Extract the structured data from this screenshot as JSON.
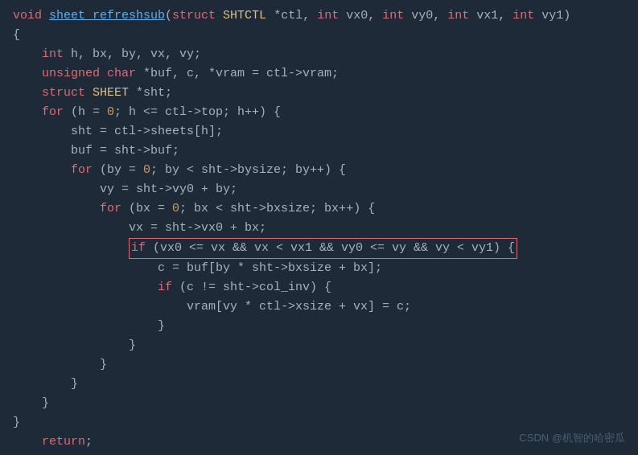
{
  "code": {
    "lines": [
      {
        "id": 1,
        "text": "void sheet_refreshsub(struct SHTCTL *ctl, int vx0, int vy0, int vx1, int vy1)"
      },
      {
        "id": 2,
        "text": "{"
      },
      {
        "id": 3,
        "text": "    int h, bx, by, vx, vy;"
      },
      {
        "id": 4,
        "text": "    unsigned char *buf, c, *vram = ctl->vram;"
      },
      {
        "id": 5,
        "text": "    struct SHEET *sht;"
      },
      {
        "id": 6,
        "text": "    for (h = 0; h <= ctl->top; h++) {"
      },
      {
        "id": 7,
        "text": "        sht = ctl->sheets[h];"
      },
      {
        "id": 8,
        "text": "        buf = sht->buf;"
      },
      {
        "id": 9,
        "text": "        for (by = 0; by < sht->bysize; by++) {"
      },
      {
        "id": 10,
        "text": "            vy = sht->vy0 + by;"
      },
      {
        "id": 11,
        "text": "            for (bx = 0; bx < sht->bxsize; bx++) {"
      },
      {
        "id": 12,
        "text": "                vx = sht->vx0 + bx;"
      },
      {
        "id": 13,
        "text": "                if (vx0 <= vx && vx < vx1 && vy0 <= vy && vy < vy1) {",
        "highlight": true
      },
      {
        "id": 14,
        "text": "                    c = buf[by * sht->bxsize + bx];"
      },
      {
        "id": 15,
        "text": "                    if (c != sht->col_inv) {"
      },
      {
        "id": 16,
        "text": "                        vram[vy * ctl->xsize + vx] = c;"
      },
      {
        "id": 17,
        "text": "                    }"
      },
      {
        "id": 18,
        "text": "                }"
      },
      {
        "id": 19,
        "text": "            }"
      },
      {
        "id": 20,
        "text": "        }"
      },
      {
        "id": 21,
        "text": "    }"
      },
      {
        "id": 22,
        "text": "}"
      },
      {
        "id": 23,
        "text": "    return;"
      },
      {
        "id": 24,
        "text": "}"
      }
    ],
    "watermark": "CSDN @机智的哈密瓜"
  }
}
